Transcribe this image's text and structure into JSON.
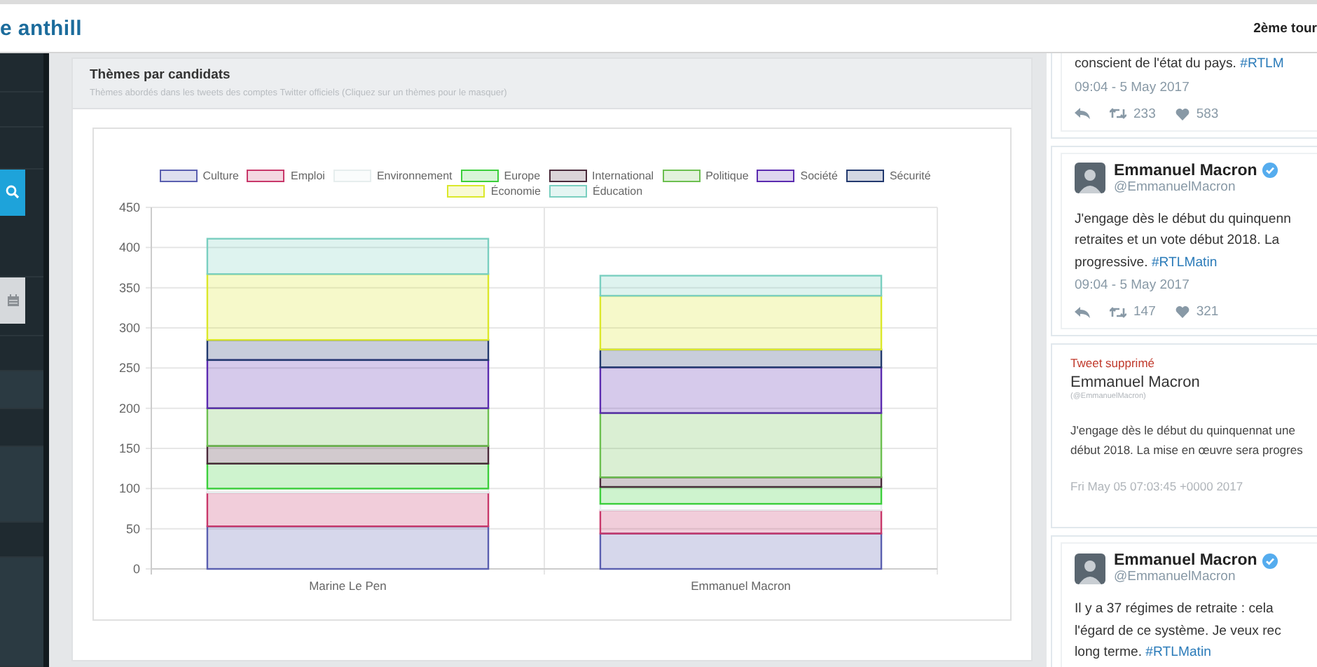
{
  "header": {
    "brand": "e anthill",
    "round": "2ème tour"
  },
  "sidebar": {
    "items": [
      {
        "kind": "search"
      },
      {
        "kind": "date"
      }
    ]
  },
  "panel": {
    "title": "Thèmes par candidats",
    "subtitle": "Thèmes abordés dans les tweets des comptes Twitter officiels (Cliquez sur un thèmes pour le masquer)",
    "chart_data": {
      "type": "bar",
      "stacked": true,
      "grid": true,
      "legend": true,
      "categories": [
        "Marine Le Pen",
        "Emmanuel Macron"
      ],
      "ylim": [
        0,
        450
      ],
      "yticks": [
        0,
        50,
        100,
        150,
        200,
        250,
        300,
        350,
        400,
        450
      ],
      "series": [
        {
          "name": "Culture",
          "color": "#5a5fb0",
          "values": [
            53,
            44
          ]
        },
        {
          "name": "Emploi",
          "color": "#c8386a",
          "values": [
            42,
            29
          ]
        },
        {
          "name": "Environnement",
          "color": "#e6eeee",
          "values": [
            5,
            8
          ]
        },
        {
          "name": "Europe",
          "color": "#3ccf3c",
          "values": [
            31,
            21
          ]
        },
        {
          "name": "International",
          "color": "#4a2a3a",
          "values": [
            22,
            12
          ]
        },
        {
          "name": "Politique",
          "color": "#6cbf50",
          "values": [
            47,
            80
          ]
        },
        {
          "name": "Société",
          "color": "#5b2bb0",
          "values": [
            60,
            57
          ]
        },
        {
          "name": "Sécurité",
          "color": "#22396e",
          "values": [
            25,
            22
          ]
        },
        {
          "name": "Économie",
          "color": "#dbe82a",
          "values": [
            82,
            67
          ]
        },
        {
          "name": "Éducation",
          "color": "#7acfc0",
          "values": [
            44,
            25
          ]
        }
      ]
    }
  },
  "tweets": [
    {
      "kind": "tweet",
      "lines": [
        {
          "text": "conscient de l'état du pays.",
          "hashtag": "#RTLM"
        }
      ],
      "time": "09:04 - 5 May 2017",
      "retweets": "233",
      "likes": "583"
    },
    {
      "kind": "tweet",
      "name": "Emmanuel Macron",
      "handle": "@EmmanuelMacron",
      "lines": [
        {
          "text": "J'engage dès le début du quinquenn"
        },
        {
          "text": "retraites et un vote début 2018. La"
        },
        {
          "text": "progressive.",
          "hashtag": "#RTLMatin"
        }
      ],
      "time": "09:04 - 5 May 2017",
      "retweets": "147",
      "likes": "321"
    },
    {
      "kind": "deleted",
      "label": "Tweet supprimé",
      "name": "Emmanuel Macron",
      "handle": "(@EmmanuelMacron)",
      "lines": [
        {
          "text": "J'engage dès le début du quinquennat une"
        },
        {
          "text": "début 2018. La mise en œuvre sera progres"
        }
      ],
      "time": "Fri May 05 07:03:45 +0000 2017"
    },
    {
      "kind": "tweet",
      "name": "Emmanuel Macron",
      "handle": "@EmmanuelMacron",
      "lines": [
        {
          "text": "Il y a 37 régimes de retraite : cela"
        },
        {
          "text": "l'égard de ce système. Je veux rec"
        },
        {
          "text": "long terme.",
          "hashtag": "#RTLMatin"
        }
      ]
    }
  ]
}
